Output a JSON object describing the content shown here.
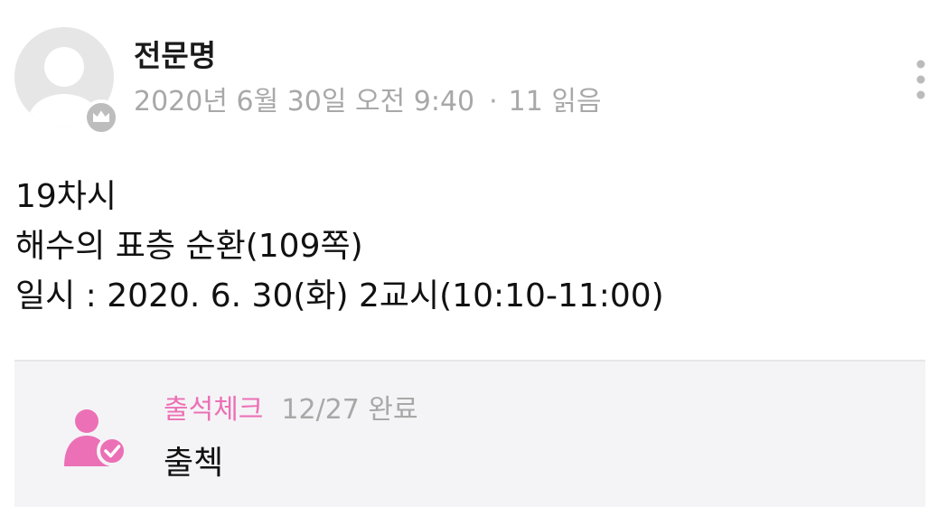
{
  "post": {
    "author": "전문명",
    "date": "2020년 6월 30일 오전 9:40",
    "separator": "·",
    "views": "11 읽음",
    "body_lines": [
      "19차시",
      "해수의 표층 순환(109쪽)",
      "일시 : 2020. 6. 30(화)  2교시(10:10-11:00)"
    ]
  },
  "comment": {
    "author": "출석체크",
    "status": "12/27 완료",
    "text": "출첵"
  },
  "icons": {
    "avatar": "default-avatar-icon",
    "badge": "crown-icon",
    "menu": "more-vertical-icon",
    "attendance": "user-check-icon"
  },
  "colors": {
    "accent_pink": "#ec70b6",
    "muted_text": "#a8a8a8",
    "comment_bg": "#f4f4f6"
  }
}
